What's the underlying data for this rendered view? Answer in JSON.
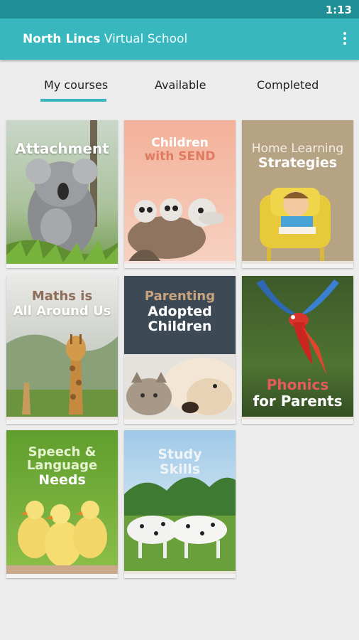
{
  "status": {
    "time": "1:13"
  },
  "appbar": {
    "title_bold": "North Lincs",
    "title_light": "Virtual School",
    "menu_icon": "more-vert-icon"
  },
  "tabs": [
    {
      "label": "My courses",
      "selected": true
    },
    {
      "label": "Available",
      "selected": false
    },
    {
      "label": "Completed",
      "selected": false
    }
  ],
  "courses": [
    {
      "title": "Attachment"
    },
    {
      "title_line1": "Children",
      "title_line2": "with SEND"
    },
    {
      "title_line1": "Home Learning",
      "title_line2": "Strategies"
    },
    {
      "title_line1": "Maths is",
      "title_line2": "All Around Us"
    },
    {
      "title_line1": "Parenting",
      "title_line2": "Adopted",
      "title_line3": "Children"
    },
    {
      "title_line1": "Phonics",
      "title_line2": "for Parents"
    },
    {
      "title_line1": "Speech &",
      "title_line2": "Language",
      "title_line3": "Needs"
    },
    {
      "title_line1": "Study",
      "title_line2": "Skills"
    }
  ],
  "colors": {
    "accent": "#38b7be",
    "statusbar": "#1f8f95",
    "background": "#ececec"
  }
}
